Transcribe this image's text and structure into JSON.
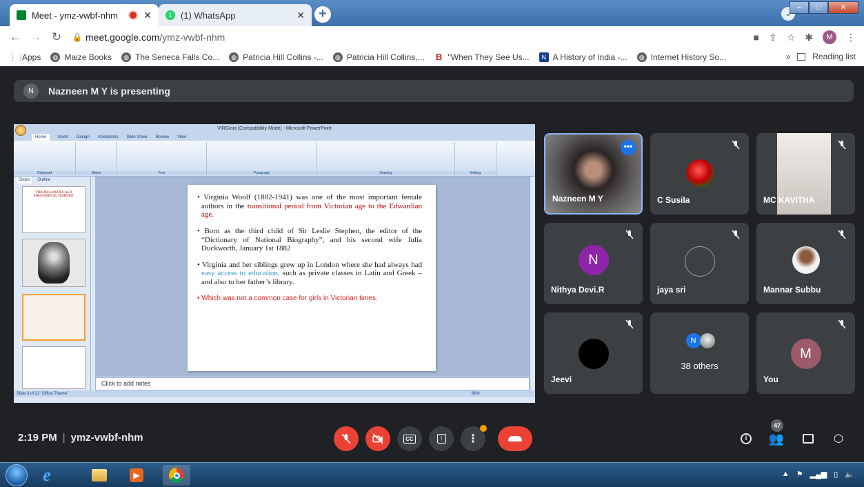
{
  "browser": {
    "tabs": [
      {
        "title": "Meet - ymz-vwbf-nhm",
        "active": true
      },
      {
        "title": "(1) WhatsApp",
        "active": false,
        "badge": "1"
      }
    ],
    "url_host": "meet.google.com",
    "url_path": "/ymz-vwbf-nhm",
    "profile_initial": "M",
    "bookmarks": [
      {
        "label": "Apps",
        "icon": "apps-icon"
      },
      {
        "label": "Maize Books",
        "icon": "globe-icon"
      },
      {
        "label": "The Seneca Falls Co...",
        "icon": "globe-icon"
      },
      {
        "label": "Patricia Hill Collins -...",
        "icon": "globe-icon"
      },
      {
        "label": "Patricia Hill Collins,...",
        "icon": "globe-icon"
      },
      {
        "label": "\"When They See Us...",
        "icon": "b-icon"
      },
      {
        "label": "A History of India -...",
        "icon": "n-icon"
      },
      {
        "label": "Internet History So...",
        "icon": "globe-icon"
      }
    ],
    "bookmarks_overflow": "»",
    "reading_list": "Reading list"
  },
  "meet": {
    "presenter_initial": "N",
    "presenting_text": "Nazneen M Y is presenting",
    "meeting_time": "2:19 PM",
    "meeting_code": "ymz-vwbf-nhm",
    "participant_count_badge": "47",
    "participants": [
      {
        "name": "Nazneen M Y",
        "type": "video",
        "speaking": true
      },
      {
        "name": "C Susila",
        "type": "rose",
        "muted": true
      },
      {
        "name": "MC KAVITHA",
        "type": "video",
        "muted": true
      },
      {
        "name": "Nithya Devi.R",
        "type": "initial",
        "initial": "N",
        "color": "#8e24aa",
        "muted": true
      },
      {
        "name": "jaya sri",
        "type": "broken-image",
        "muted": true
      },
      {
        "name": "Mannar Subbu",
        "type": "photo",
        "muted": true
      },
      {
        "name": "Jeevi",
        "type": "black",
        "muted": true
      },
      {
        "name": "38 others",
        "type": "group",
        "initial": "N"
      },
      {
        "name": "You",
        "type": "initial",
        "initial": "M",
        "color": "#9c5a6b",
        "muted": true
      }
    ]
  },
  "ppt": {
    "window_title": "VIRGinia [Compatibility Mode] - Microsoft PowerPoint",
    "tabs": [
      "Home",
      "Insert",
      "Design",
      "Animations",
      "Slide Show",
      "Review",
      "View"
    ],
    "ribbon_groups": [
      "Clipboard",
      "Slides",
      "Font",
      "Paragraph",
      "Drawing",
      "Editing"
    ],
    "pane_tabs": [
      "Slides",
      "Outline"
    ],
    "thumb1_title": "VIRGINIA WOOLF AS A PHENOMENAL FEMINIST",
    "bullets": [
      {
        "pre": "Virginia Woolf (1882-1941) was one of the most important female authors in the ",
        "hl": "transitional period from Victorian age to the Edwardian age.",
        "post": "",
        "hlcolor": "red"
      },
      {
        "pre": "Born as the third child of Sir Leslie Stephen, the editor of the “Dictionary of National Biography”, and his second wife Julia Duckworth, January 1st 1882",
        "hl": "",
        "post": ""
      },
      {
        "pre": "Virginia and her siblings grew up in London where she had always had ",
        "hl": "easy access to education,",
        "post": " such as private classes in Latin and Greek – and also to her father’s library.",
        "hlcolor": "blue"
      }
    ],
    "last_bullet": "• Which was not a common case for girls in Victorian times.",
    "notes_placeholder": "Click to add notes",
    "status_left": "Slide 3 of 22    \"Office Theme\"",
    "zoom": "66%"
  },
  "colors": {
    "meet_bg": "#202124",
    "tile_bg": "#3c4043",
    "end_call": "#ea4335",
    "accent": "#1a73e8"
  }
}
